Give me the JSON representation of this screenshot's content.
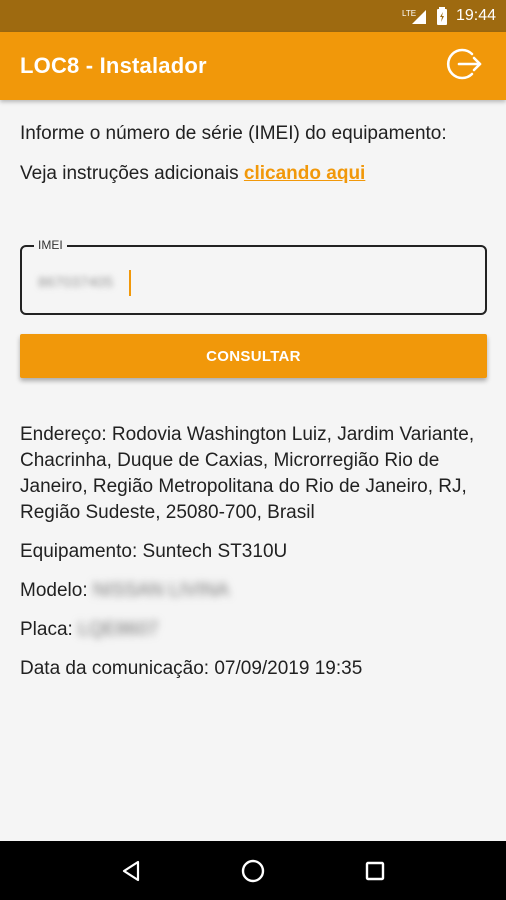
{
  "status_bar": {
    "time": "19:44",
    "icons": [
      "lte-signal-icon",
      "battery-icon"
    ]
  },
  "app_bar": {
    "title": "LOC8 - Instalador",
    "logout_icon": "logout-icon"
  },
  "form": {
    "instruction": "Informe o número de série (IMEI) do equipamento:",
    "extra_prefix": "Veja instruções adicionais ",
    "extra_link": "clicando aqui",
    "imei_label": "IMEI",
    "imei_value": "867037405",
    "consult_button": "CONSULTAR"
  },
  "result": {
    "address_label": "Endereço:",
    "address_value": "Rodovia Washington Luiz, Jardim Variante, Chacrinha, Duque de Caxias, Microrregião Rio de Janeiro, Região Metropolitana do Rio de Janeiro, RJ, Região Sudeste, 25080-700, Brasil",
    "equipment_label": "Equipamento:",
    "equipment_value": "Suntech ST310U",
    "model_label": "Modelo:",
    "model_value": "NISSAN LIVINA",
    "plate_label": "Placa:",
    "plate_value": "LQE8607",
    "date_label": "Data da comunicação:",
    "date_value": "07/09/2019 19:35"
  },
  "nav_bar": {
    "icons": [
      "back-icon",
      "home-icon",
      "recents-icon"
    ]
  },
  "colors": {
    "accent": "#f1980a",
    "status_bar": "#9e6a10",
    "background": "#f5f5f5"
  }
}
